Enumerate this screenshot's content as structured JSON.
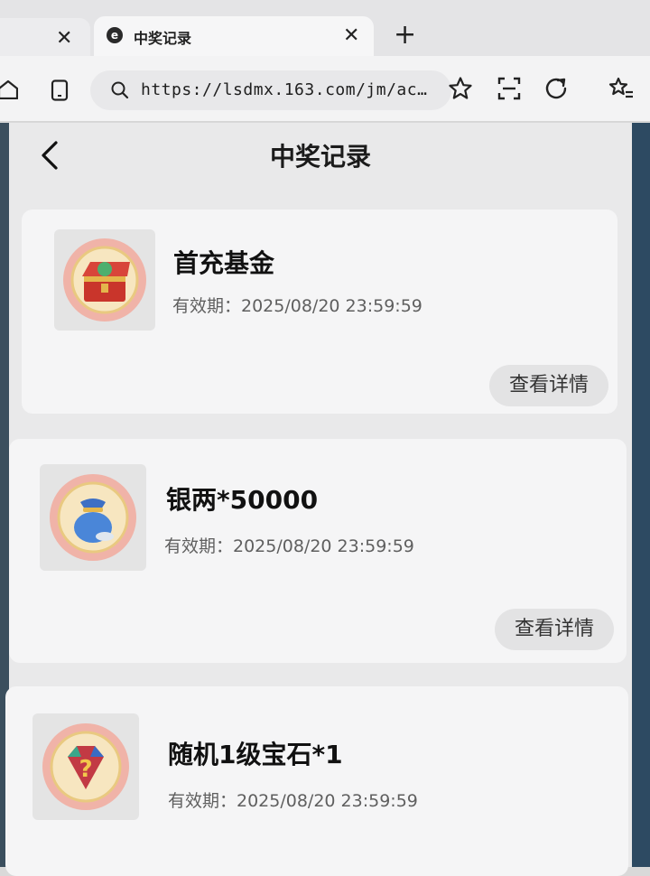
{
  "browser": {
    "prev_tab_close": "✕",
    "active_tab": {
      "title": "中奖记录",
      "close": "✕"
    },
    "new_tab": "+",
    "url": "https://lsdmx.163.com/jm/ac…"
  },
  "page": {
    "title": "中奖记录",
    "prizes": [
      {
        "name": "首充基金",
        "validity": "有效期：2025/08/20 23:59:59",
        "detail_label": "查看详情",
        "icon": "treasure-chest-icon"
      },
      {
        "name": "银两*50000",
        "validity": "有效期：2025/08/20 23:59:59",
        "detail_label": "查看详情",
        "icon": "money-bag-icon"
      },
      {
        "name": "随机1级宝石*1",
        "validity": "有效期：2025/08/20 23:59:59",
        "icon": "mystery-gem-icon"
      }
    ]
  },
  "colors": {
    "card_bg": "#f5f5f6",
    "page_bg": "#e9e9ea",
    "button_bg": "#e3e3e4"
  }
}
